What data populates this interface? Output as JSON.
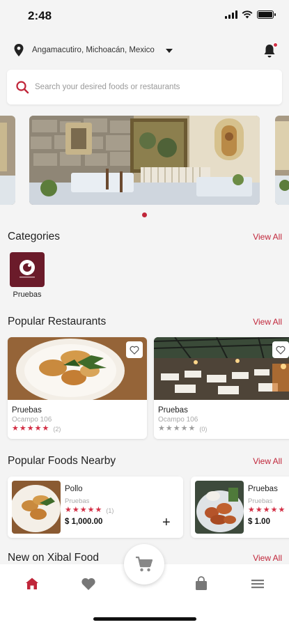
{
  "status": {
    "time": "2:48"
  },
  "location": {
    "label": "Angamacutiro, Michoacán, Mexico"
  },
  "search": {
    "placeholder": "Search your desired foods or restaurants"
  },
  "sections": {
    "categories": {
      "title": "Categories",
      "view_all": "View All"
    },
    "popular_restaurants": {
      "title": "Popular Restaurants",
      "view_all": "View All"
    },
    "popular_foods": {
      "title": "Popular Foods Nearby",
      "view_all": "View All"
    },
    "new_on": {
      "title": "New on Xibal Food",
      "view_all": "View All"
    }
  },
  "categories": [
    {
      "label": "Pruebas"
    }
  ],
  "restaurants": [
    {
      "name": "Pruebas",
      "address": "Ocampo 106",
      "rating": 5,
      "count": "(2)"
    },
    {
      "name": "Pruebas",
      "address": "Ocampo 106",
      "rating": 0,
      "count": "(0)"
    }
  ],
  "foods": [
    {
      "name": "Pollo",
      "restaurant": "Pruebas",
      "rating": 5,
      "count": "(1)",
      "price": "$ 1,000.00",
      "add": "+"
    },
    {
      "name": "Pruebas",
      "restaurant": "Pruebas",
      "rating": 5,
      "count": "",
      "price": "$ 1.00"
    }
  ],
  "colors": {
    "accent": "#c0263a",
    "star_on": "#d32f45",
    "star_off": "#9e9e9e"
  },
  "icons": {
    "location": "map-pin-icon",
    "notification": "bell-icon",
    "search": "search-icon",
    "favorite": "heart-outline-icon",
    "nav": [
      "home-icon",
      "heart-icon",
      "cart-icon",
      "bag-icon",
      "menu-icon"
    ]
  }
}
